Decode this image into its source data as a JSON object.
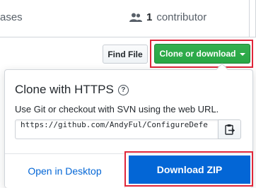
{
  "repo_bar": {
    "releases_partial": "ases",
    "contributor_count": "1",
    "contributor_label": "contributor"
  },
  "toolbar": {
    "find_file_label": "Find File",
    "clone_label": "Clone or download"
  },
  "clone_popover": {
    "title": "Clone with HTTPS",
    "description": "Use Git or checkout with SVN using the web URL.",
    "url": "https://github.com/AndyFul/ConfigureDefe",
    "open_desktop_label": "Open in Desktop",
    "download_zip_label": "Download ZIP"
  },
  "colors": {
    "highlight": "#e0263a",
    "clone_green": "#28a745",
    "download_blue": "#0366d6",
    "link_blue": "#0366d6"
  },
  "icons": {
    "contributors": "people-icon",
    "help": "question-icon",
    "copy": "clipboard-icon",
    "dropdown": "caret-down-icon"
  }
}
